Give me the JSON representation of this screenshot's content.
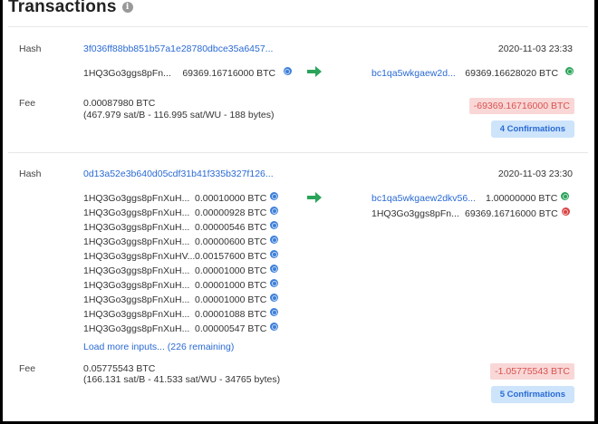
{
  "header": {
    "title": "Transactions",
    "info_icon": "i"
  },
  "tx1": {
    "hash_label": "Hash",
    "hash": "3f036ff88bb851b57a1e28780dbce35a6457...",
    "datetime": "2020-11-03 23:33",
    "input_addr": "1HQ3Go3ggs8pFn...",
    "input_amount": "69369.16716000 BTC",
    "output_addr": "bc1qa5wkgaew2d...",
    "output_amount": "69369.16628020 BTC",
    "fee_label": "Fee",
    "fee": "0.00087980 BTC",
    "fee_detail": "(467.979 sat/B - 116.995 sat/WU - 188 bytes)",
    "net": "-69369.16716000 BTC",
    "confirmations": "4 Confirmations"
  },
  "tx2": {
    "hash_label": "Hash",
    "hash": "0d13a52e3b640d05cdf31b41f335b327f126...",
    "datetime": "2020-11-03 23:30",
    "inputs": [
      {
        "addr": "1HQ3Go3ggs8pFnXuH...",
        "amount": "0.00010000 BTC"
      },
      {
        "addr": "1HQ3Go3ggs8pFnXuH...",
        "amount": "0.00000928 BTC"
      },
      {
        "addr": "1HQ3Go3ggs8pFnXuH...",
        "amount": "0.00000546 BTC"
      },
      {
        "addr": "1HQ3Go3ggs8pFnXuH...",
        "amount": "0.00000600 BTC"
      },
      {
        "addr": "1HQ3Go3ggs8pFnXuHV...",
        "amount": "0.00157600 BTC"
      },
      {
        "addr": "1HQ3Go3ggs8pFnXuH...",
        "amount": "0.00001000 BTC"
      },
      {
        "addr": "1HQ3Go3ggs8pFnXuH...",
        "amount": "0.00001000 BTC"
      },
      {
        "addr": "1HQ3Go3ggs8pFnXuH...",
        "amount": "0.00001000 BTC"
      },
      {
        "addr": "1HQ3Go3ggs8pFnXuH...",
        "amount": "0.00001088 BTC"
      },
      {
        "addr": "1HQ3Go3ggs8pFnXuH...",
        "amount": "0.00000547 BTC"
      }
    ],
    "load_more": "Load more inputs... (226 remaining)",
    "outputs": [
      {
        "addr": "bc1qa5wkgaew2dkv56...",
        "amount": "1.00000000 BTC",
        "status": "green"
      },
      {
        "addr": "1HQ3Go3ggs8pFn...",
        "amount": "69369.16716000 BTC",
        "status": "red"
      }
    ],
    "fee_label": "Fee",
    "fee": "0.05775543 BTC",
    "fee_detail": "(166.131 sat/B - 41.533 sat/WU - 34765 bytes)",
    "net": "-1.05775543 BTC",
    "confirmations": "5 Confirmations"
  },
  "colors": {
    "link": "#2a6ad4",
    "arrow": "#2aa45a",
    "negative_bg": "#f9d7d7",
    "negative_text": "#d9534f",
    "confirm_bg": "#cde4fb"
  }
}
